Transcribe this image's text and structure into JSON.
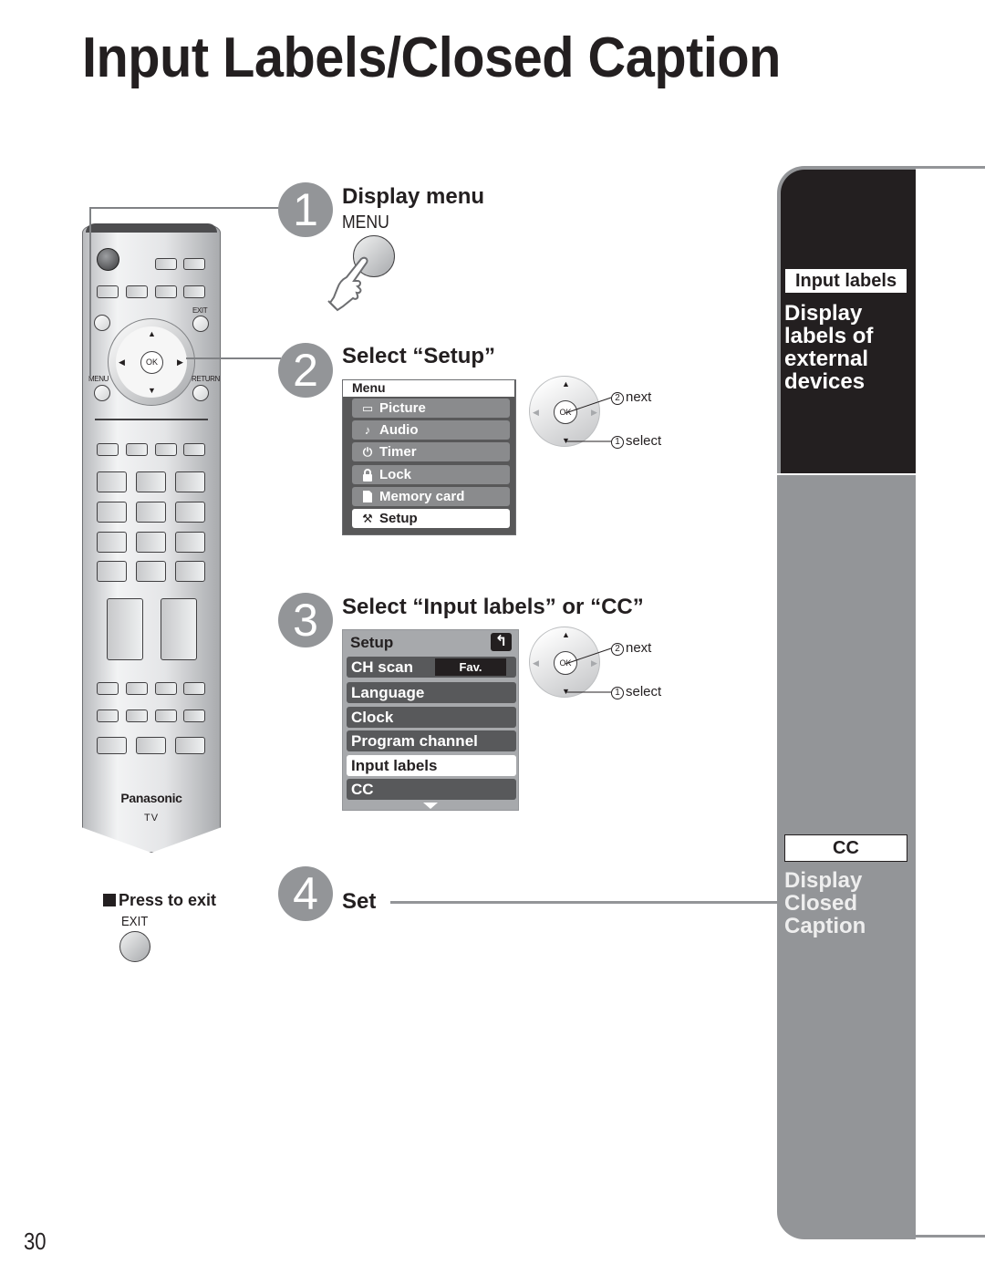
{
  "page": {
    "title": "Input Labels/Closed Caption",
    "page_number": "30"
  },
  "remote": {
    "brand": "Panasonic",
    "model": "TV",
    "labels": {
      "exit": "EXIT",
      "menu": "MENU",
      "return": "RETURN",
      "ok": "OK"
    }
  },
  "steps": [
    {
      "number": "1",
      "heading": "Display menu",
      "button_label": "MENU"
    },
    {
      "number": "2",
      "heading": "Select “Setup”"
    },
    {
      "number": "3",
      "heading": "Select “Input labels” or “CC”"
    },
    {
      "number": "4",
      "heading": "Set"
    }
  ],
  "menu_screen": {
    "title": "Menu",
    "items": [
      {
        "label": "Picture",
        "icon": "picture-icon",
        "glyph": "▭"
      },
      {
        "label": "Audio",
        "icon": "audio-icon",
        "glyph": "♪"
      },
      {
        "label": "Timer",
        "icon": "timer-icon",
        "glyph": "⏻"
      },
      {
        "label": "Lock",
        "icon": "lock-icon",
        "glyph": "🔒"
      },
      {
        "label": "Memory card",
        "icon": "memory-card-icon",
        "glyph": "■"
      },
      {
        "label": "Setup",
        "icon": "setup-icon",
        "glyph": "⚒",
        "selected": true
      }
    ]
  },
  "setup_screen": {
    "title": "Setup",
    "return_glyph": "↰",
    "items": [
      {
        "label": "CH scan",
        "value": "Fav."
      },
      {
        "label": "Language"
      },
      {
        "label": "Clock"
      },
      {
        "label": "Program channel"
      },
      {
        "label": "Input labels",
        "selected": true
      },
      {
        "label": "CC"
      }
    ]
  },
  "nav_hint": {
    "ok": "OK",
    "next_num": "2",
    "next": "next",
    "select_num": "1",
    "select": "select"
  },
  "side_tab": {
    "input_labels_tag": "Input labels",
    "input_labels_desc": [
      "Display",
      "labels of",
      "external",
      "devices"
    ],
    "cc_tag": "CC",
    "cc_desc": [
      "Display",
      "Closed",
      "Caption"
    ]
  },
  "exit_section": {
    "label": "Press to exit",
    "button_label": "EXIT"
  },
  "colors": {
    "dark": "#231f20",
    "gray": "#939598",
    "menu_bg": "#585859"
  }
}
